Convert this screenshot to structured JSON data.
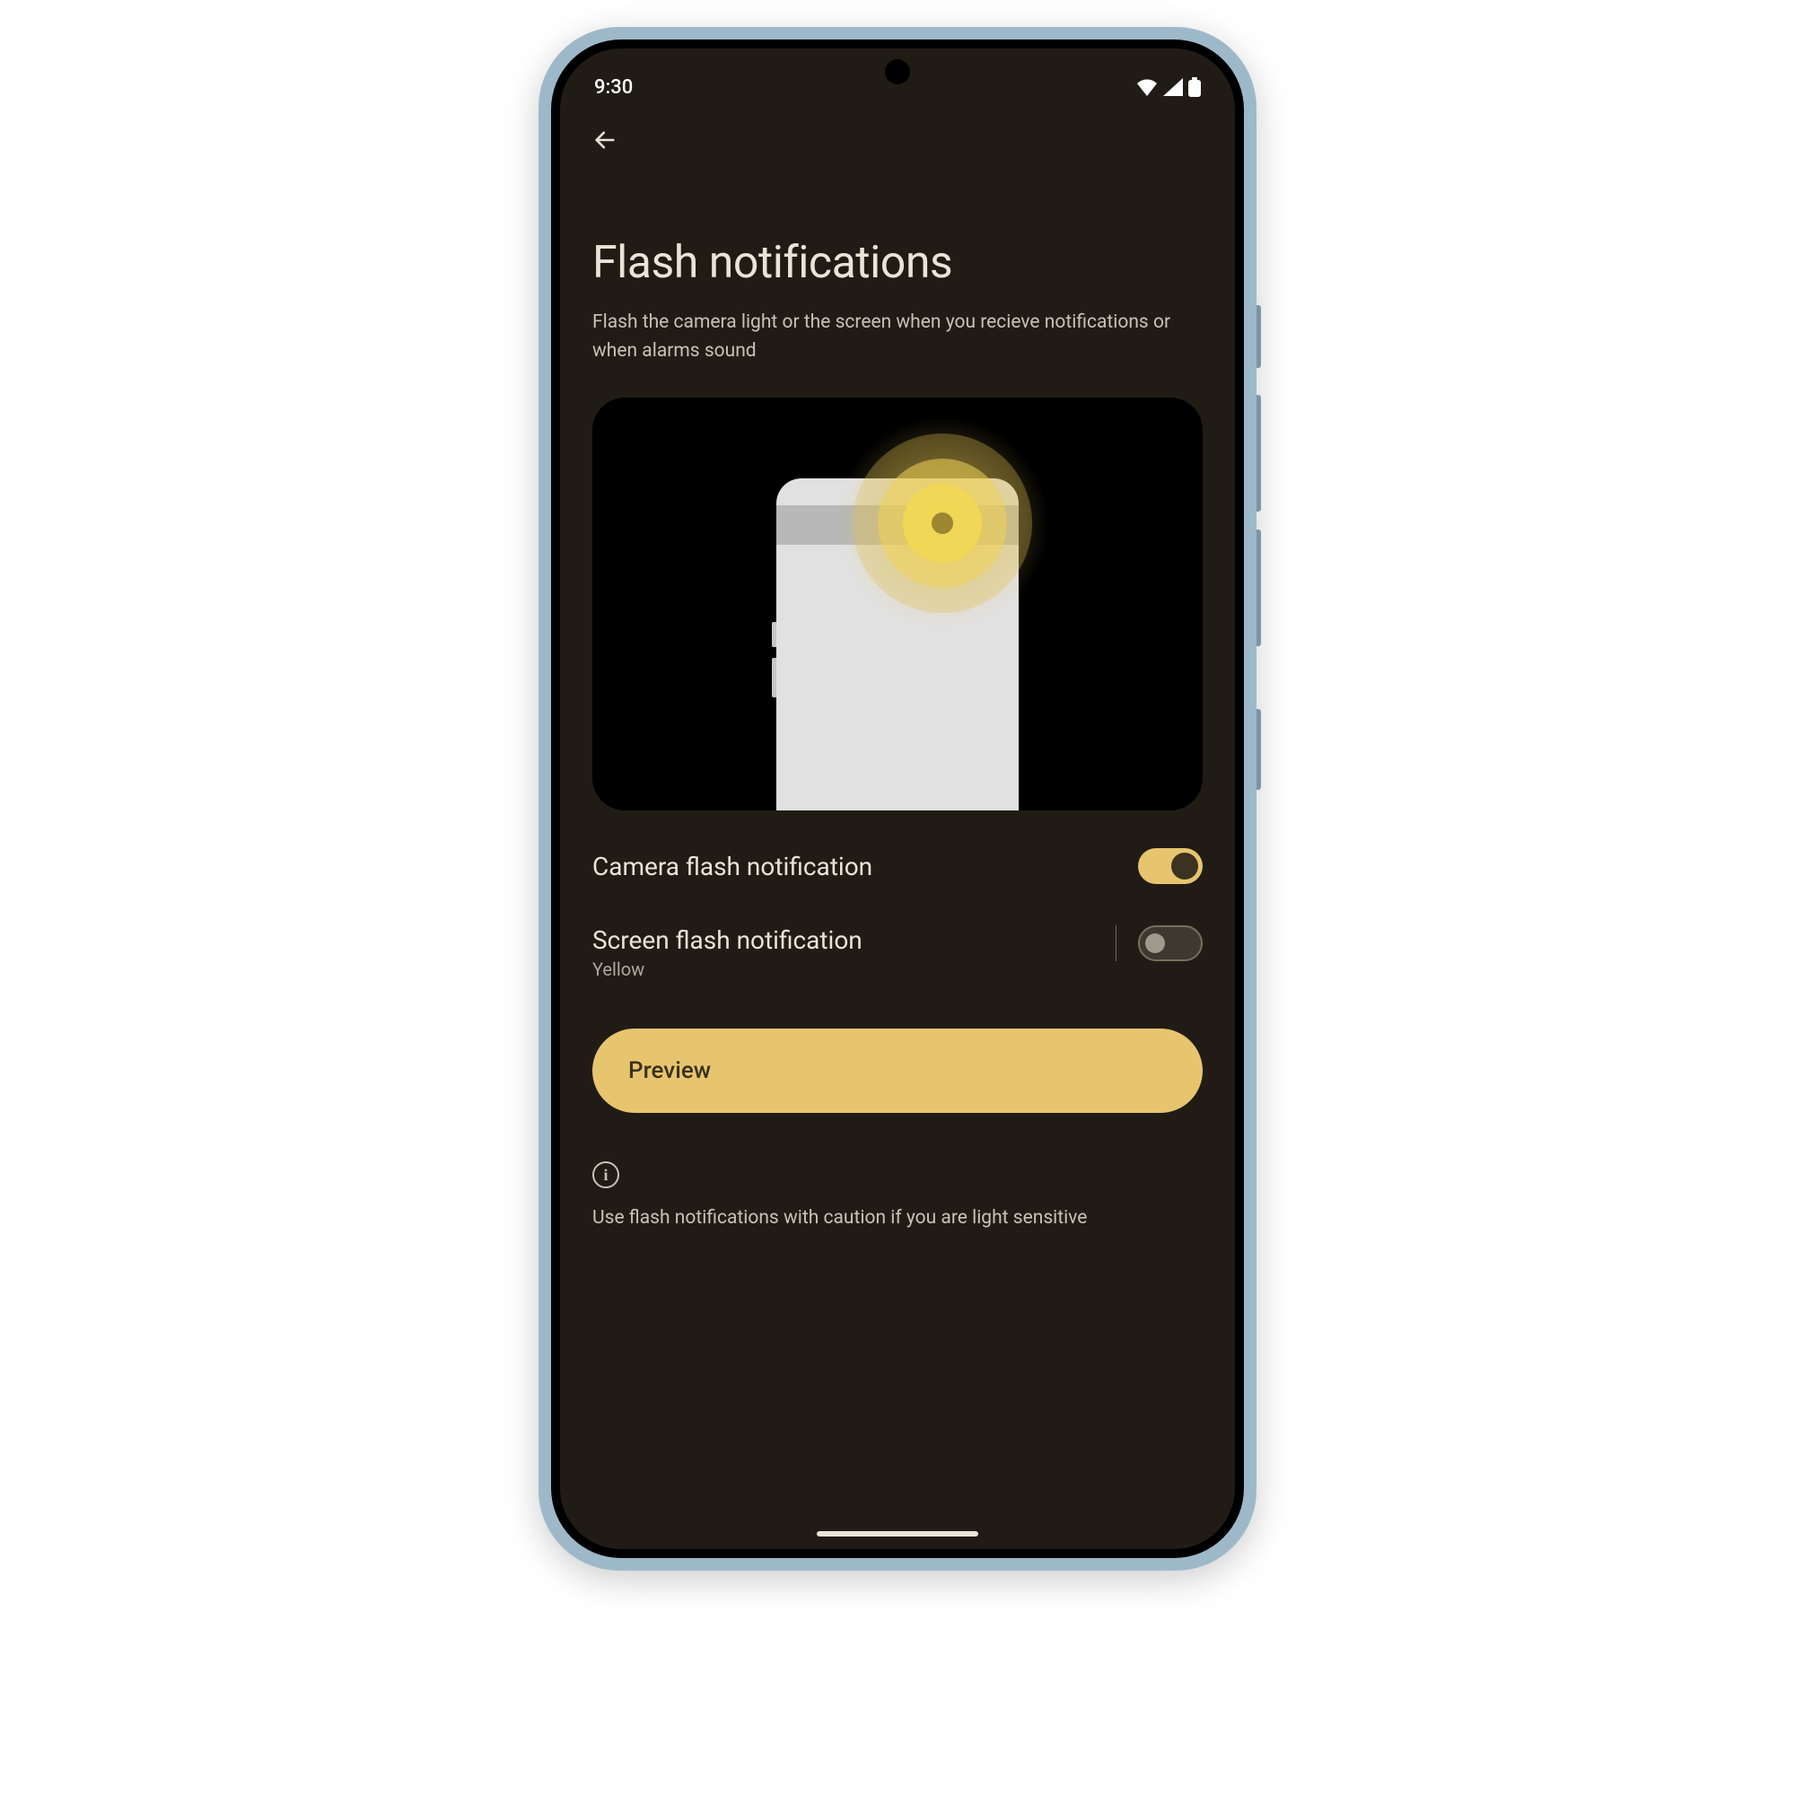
{
  "status": {
    "time": "9:30"
  },
  "page": {
    "title": "Flash notifications",
    "subtitle": "Flash the camera light or the screen when you recieve notifications or when alarms sound"
  },
  "settings": {
    "camera_flash": {
      "label": "Camera flash notification",
      "enabled": true
    },
    "screen_flash": {
      "label": "Screen flash notification",
      "sublabel": "Yellow",
      "enabled": false
    }
  },
  "preview_button": "Preview",
  "info": {
    "text": "Use flash notifications with caution if you are light sensitive"
  },
  "colors": {
    "accent": "#e7c56f",
    "background": "#201c15",
    "text_primary": "#eae3d7",
    "text_secondary": "#c7c2b8"
  }
}
